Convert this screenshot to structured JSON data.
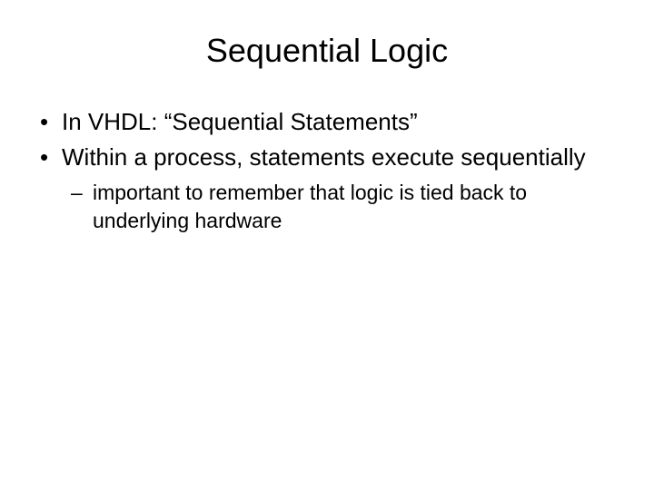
{
  "slide": {
    "title": "Sequential Logic",
    "bullets": [
      {
        "text": "In VHDL: “Sequential Statements”"
      },
      {
        "text": "Within a process, statements execute sequentially",
        "sub": [
          "important to remember that logic is tied back to underlying hardware"
        ]
      }
    ]
  }
}
